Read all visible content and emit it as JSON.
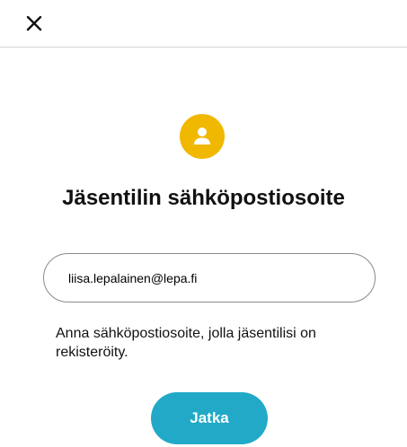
{
  "header": {
    "close_icon": "close-icon"
  },
  "avatar": {
    "icon": "person-icon",
    "color": "#f0b800"
  },
  "title": "Jäsentilin sähköpostiosoite",
  "email_field": {
    "value": "liisa.lepalainen@lepa.fi"
  },
  "helper_text": "Anna sähköpostiosoite, jolla jäsentilisi on rekisteröity.",
  "continue_button": {
    "label": "Jatka",
    "color": "#21a9c7"
  }
}
